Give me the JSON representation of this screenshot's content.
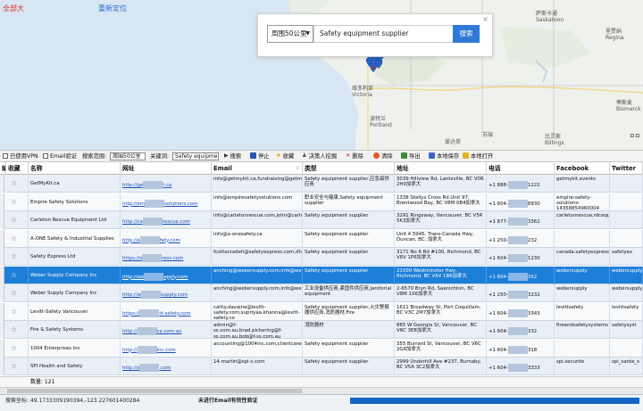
{
  "map": {
    "top_left_link": "全部大",
    "relocate_link": "重新定位",
    "places": [
      {
        "name": "萨斯卡通",
        "sub": "Saskatoon"
      },
      {
        "name": "里贾纳",
        "sub": "Regina"
      },
      {
        "name": "维多利亚",
        "sub": "Victoria"
      },
      {
        "name": "波特兰",
        "sub": "Portland"
      },
      {
        "name": "苏瑞",
        "sub": ""
      },
      {
        "name": "爱达荷",
        "sub": ""
      },
      {
        "name": "比灵斯",
        "sub": "Billings"
      },
      {
        "name": "俾斯麦",
        "sub": "Bismarck"
      }
    ],
    "search": {
      "range_value": "周围50公里",
      "keyword_value": "Safety equipment supplier",
      "search_label": "搜索",
      "close_label": "×"
    }
  },
  "toolbar": {
    "vpn_label": "已使用VPN",
    "email_verify_label": "Email验证",
    "range_prefix": "搜索范围:",
    "range_value": "周围50公里",
    "keyword_prefix": "关键词:",
    "keyword_value": "Safety equipme",
    "search": "搜索",
    "stop": "停止",
    "favorite": "收藏",
    "decision_maker": "决策人挖掘",
    "delete": "删除",
    "dedupe": "清除",
    "export": "导出",
    "save_local": "本地保存",
    "open_local": "本地打开"
  },
  "columns": [
    "编",
    "收藏",
    "名称",
    "网址",
    "Email",
    "类型",
    "地址",
    "电话",
    "Facebook",
    "Twitter"
  ],
  "colors": {
    "selected_row": "#1e7fd8",
    "accent": "#2f7ad8",
    "alt_row": "#e9eff6"
  },
  "rows": [
    {
      "name": "GetMyKit.ca",
      "url_a": "http://ge",
      "url_b": "t.ca",
      "email": "info@getmykit.ca,fundraising@getmykit.ca",
      "type": "Safety equipment supplier,应急袋供应商",
      "address": "3039 Hillview Rd, Lantzville, BC V0R 2H0加拿大",
      "phone_a": "+1 888-",
      "phone_b": "1222",
      "facebook": "getmykit.events",
      "twitter": ""
    },
    {
      "name": "Empire Safety Solutions",
      "url_a": "http://em",
      "url_b": "solutions.com",
      "email": "info@empiresafetysolutions.com",
      "type": "职业安全与健康,Safety equipment supplier",
      "address": "1338 Stellys Cross Rd Unit 97, Brentwood Bay, BC V8M 0B4加拿大",
      "phone_a": "+1 604-",
      "phone_b": "8930",
      "facebook": "empire-safety-solutions-14358854960004",
      "twitter": ""
    },
    {
      "name": "Carleton Rescue Equipment Ltd",
      "url_a": "http://ca",
      "url_b": "rescue.com",
      "email": "info@carletonrescue.com,john@carletonrescue.com,dean@carletonres",
      "type": "Safety equipment supplier",
      "address": "3291 Ringsway, Vancouver, BC V5R 5K3加拿大",
      "phone_a": "+1 877-",
      "phone_b": "3362",
      "facebook": "carletonrescue,rdcequipment,carletonre",
      "twitter": ""
    },
    {
      "name": "A-ONE Safety & Industrial Supplies",
      "url_a": "http://a",
      "url_b": "fety.com",
      "email": "info@a-onesafety.ca",
      "type": "Safety equipment supplier",
      "address": "Unit 4 5945, Trans-Canada Hwy, Duncan, BC, 加拿大",
      "phone_a": "+1 250-",
      "phone_b": "232",
      "facebook": "",
      "twitter": ""
    },
    {
      "name": "Safety Express Ltd",
      "url_a": "https://s",
      "url_b": "ress.com",
      "email": "fcottarzadeh@safetyexpress.com,dhanson@safetyexpress.com,pbennet",
      "type": "Safety equipment supplier",
      "address": "3171 No 6 Rd #100, Richmond, BC V6V 1P6加拿大",
      "phone_a": "+1 604-",
      "phone_b": "1230",
      "facebook": "canada.safetyexpress",
      "twitter": "safetyex"
    },
    {
      "name": "Weber Supply Company Inc",
      "url_a": "http://we",
      "url_b": "apply.com",
      "email": "anching@webersupply.com,info@webersupply.com,pradeal@webersuppl",
      "type": "Safety equipment supplier",
      "address": "21500 Westminster Hwy, Richmond, BC V6V 1B6加拿大",
      "phone_a": "+1 604-",
      "phone_b": "352",
      "facebook": "webersupply",
      "twitter": "webersupply"
    },
    {
      "name": "Weber Supply Company Inc",
      "url_a": "http://w",
      "url_b": "supply.com",
      "email": "anching@webersupply.com,info@webersupply.com,pradeal@webersuppl",
      "type": "工业设备供应商,紧固件供应商,Janitorial equipment",
      "address": "2-6570 Bryn Rd, Saanichton, BC V8M 1X6加拿大",
      "phone_a": "+1 250-",
      "phone_b": "3232",
      "facebook": "webersupply",
      "twitter": "webersupply"
    },
    {
      "name": "Levitt-Safety Vancouver",
      "url_a": "https://",
      "url_b": "tt-safety.com",
      "email": "cathy.davaine@levitt-safety.com,supriyaa.khanna@levitt-safety.co",
      "type": "Safety equipment supplier,火灾警报器供应商,消防器材,Fire",
      "address": "1611 Broadway St, Port Coquitlam, BC V3C 2M7加拿大",
      "phone_a": "+1 604-",
      "phone_b": "3343",
      "facebook": "levittsafety",
      "twitter": "levittsafety"
    },
    {
      "name": "Fire & Safety Systems",
      "url_a": "http://",
      "url_b": "ce.com.au",
      "email": "admin@f-ss.com.au,brad.pickering@f-ss.com.au,bob@f-ss.com.au",
      "type": "消防器材",
      "address": "885 W Georgia St, Vancouver, BC V6C 3E8加拿大",
      "phone_a": "+1 604-",
      "phone_b": "332",
      "facebook": "fireandsafetysystems",
      "twitter": "safetysyst"
    },
    {
      "name": "1004 Enterprises Inc",
      "url_a": "http://",
      "url_b": "inc.com",
      "email": "accounting@1004inc.com,clientcare@1004inc.com,info@1004inc.com",
      "type": "Safety equipment supplier",
      "address": "355 Burrard St, Vancouver, BC V6C 2G8加拿大",
      "phone_a": "+1 604-",
      "phone_b": "318",
      "facebook": "",
      "twitter": ""
    },
    {
      "name": "SPI Health and Safety",
      "url_a": "http://s",
      "url_b": ".com",
      "email": "14.martin@spi-s.com",
      "type": "Safety equipment supplier",
      "address": "2999 Underhill Ave #237, Burnaby, BC V5A 3C2加拿大",
      "phone_a": "+1 604-",
      "phone_b": "3333",
      "facebook": "spi.securite",
      "twitter": "spi_sante_s"
    }
  ],
  "count_label": "数量: 121",
  "status": {
    "coords": "搜索坐标: 49.1733309190394,-123.227601400284",
    "email_status": "未进行Email有效性验证",
    "progress": 1.0
  }
}
